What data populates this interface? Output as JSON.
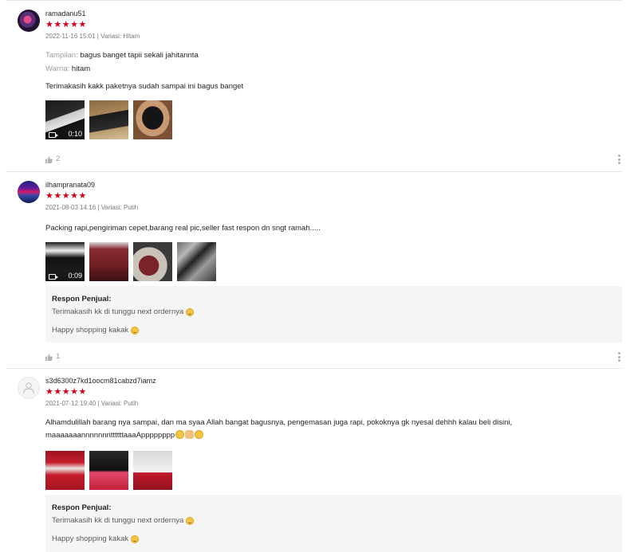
{
  "reviews": [
    {
      "username": "ramadanu51",
      "stars": "★★★★★",
      "meta": "2022-11-16 15:01 | Variasi: Hitam",
      "attributes": [
        {
          "key": "Tampilan:",
          "value": "bagus banget tapii sekali jahitannta"
        },
        {
          "key": "Warna:",
          "value": "hitam"
        }
      ],
      "comment": "Terimakasih kakk paketnya sudah sampai ini bagus banget",
      "video_duration": "0:10",
      "likes": "2"
    },
    {
      "username": "ilhampranata09",
      "stars": "★★★★★",
      "meta": "2021-08-03 14:16 | Variasi: Putih",
      "comment": "Packing rapi,pengiriman cepet,barang real pic,seller fast respon dn sngt ramah.....",
      "video_duration": "0:09",
      "response": {
        "title": "Respon Penjual:",
        "line1": "Terimakasih kk di tunggu next ordernya",
        "line2": "Happy shopping kakak"
      },
      "likes": "1"
    },
    {
      "username": "s3d6300z7kd1oocm81cabzd7iamz",
      "stars": "★★★★★",
      "meta": "2021-07-12 19:40 | Variasi: Putih",
      "comment_line1": "Alhamdulillah barang nya sampai, dan ma syaa Allah bangat bagusnya, pengemasan juga rapi, pokoknya gk nyesal dehhh kalau beli disini,",
      "comment_line2": "maaaaaaannnnnnnttttttaaaApppppppp",
      "response": {
        "title": "Respon Penjual:",
        "line1": "Terimakasih kk di tunggu next ordernya",
        "line2": "Happy shopping kakak"
      }
    }
  ],
  "icons": {
    "star": "star-icon",
    "like": "thumbs-up-icon",
    "more": "more-vertical-icon",
    "video": "video-camera-icon",
    "smiley": "smiley-emoji-icon"
  },
  "colors": {
    "star": "#d0011b",
    "divider": "#e4e4e4",
    "response_bg": "#f5f5f5"
  }
}
